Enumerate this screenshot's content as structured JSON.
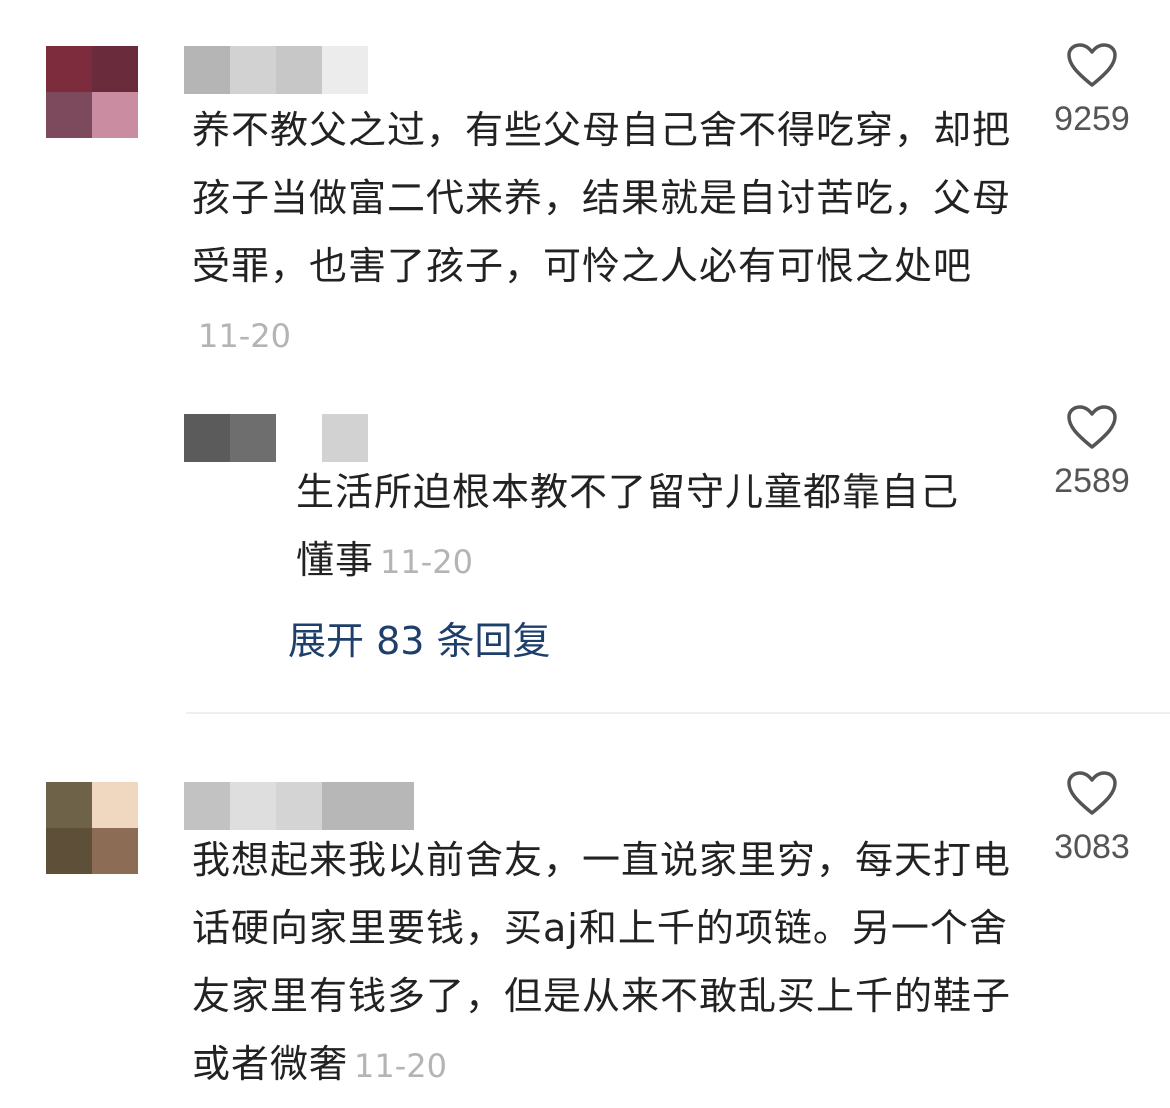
{
  "comments": [
    {
      "text": "养不教父之过，有些父母自己舍不得吃穿，却把孩子当做富二代来养，结果就是自讨苦吃，父母受罪，也害了孩子，可怜之人必有可恨之处吧",
      "date": "11-20",
      "likes": "9259",
      "avatar_colors": [
        "#7c2c3c",
        "#6a2b3d",
        "#7c4a5c",
        "#c98ca0"
      ],
      "name_colors": [
        "#b5b5b5",
        "#d2d2d2",
        "#c7c7c7",
        "#ececec"
      ],
      "reply": {
        "text": "生活所迫根本教不了留守儿童都靠自己懂事",
        "date": "11-20",
        "likes": "2589",
        "name_colors": [
          "#5b5b5b",
          "#6e6e6e",
          "#ffffff",
          "#d2d2d2"
        ]
      },
      "expand_label": "展开 83 条回复"
    },
    {
      "text": "我想起来我以前舍友，一直说家里穷，每天打电话硬向家里要钱，买aj和上千的项链。另一个舍友家里有钱多了，但是从来不敢乱买上千的鞋子或者微奢",
      "date": "11-20",
      "likes": "3083",
      "avatar_colors": [
        "#6e6348",
        "#efd8bf",
        "#5e5038",
        "#8c6c55"
      ],
      "name_colors": [
        "#c2c2c2",
        "#dedede",
        "#d4d4d4",
        "#b7b7b7",
        "#b7b7b7"
      ]
    }
  ],
  "icons": {
    "like": "heart-outline-icon"
  }
}
